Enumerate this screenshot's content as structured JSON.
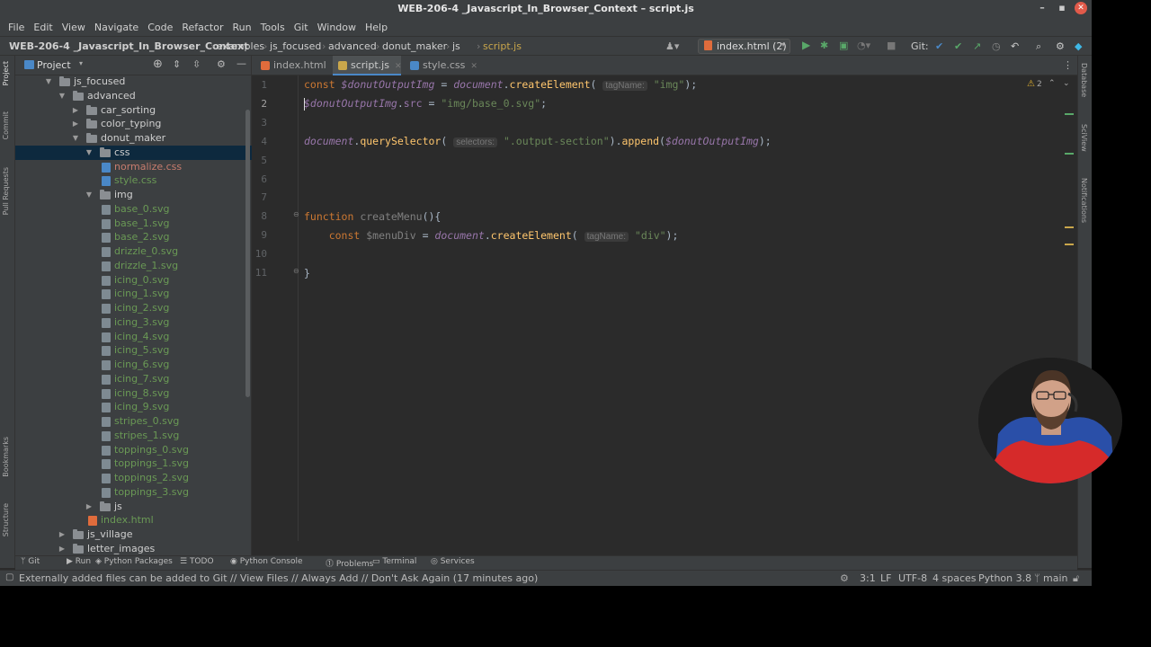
{
  "window": {
    "title": "WEB-206-4 _Javascript_In_Browser_Context – script.js"
  },
  "menu": [
    "File",
    "Edit",
    "View",
    "Navigate",
    "Code",
    "Refactor",
    "Run",
    "Tools",
    "Git",
    "Window",
    "Help"
  ],
  "breadcrumbs": [
    "WEB-206-4 _Javascript_In_Browser_Context",
    "examples",
    "js_focused",
    "advanced",
    "donut_maker",
    "js",
    "script.js"
  ],
  "run_config": "index.html (2)",
  "git_label": "Git:",
  "side_tabs": {
    "project": "Project",
    "commit": "Commit",
    "pull_requests": "Pull Requests",
    "bookmarks": "Bookmarks",
    "structure": "Structure",
    "database": "Database",
    "sciview": "SciView",
    "notifications": "Notifications"
  },
  "project": {
    "title": "Project",
    "tree": [
      {
        "label": "js_focused",
        "type": "folder",
        "depth": 2,
        "open": true
      },
      {
        "label": "advanced",
        "type": "folder",
        "depth": 3,
        "open": true
      },
      {
        "label": "car_sorting",
        "type": "folder",
        "depth": 4,
        "open": false
      },
      {
        "label": "color_typing",
        "type": "folder",
        "depth": 4,
        "open": false
      },
      {
        "label": "donut_maker",
        "type": "folder",
        "depth": 4,
        "open": true
      },
      {
        "label": "css",
        "type": "folder",
        "depth": 5,
        "open": true,
        "selected": true
      },
      {
        "label": "normalize.css",
        "type": "file",
        "depth": 6,
        "color": "#c77c6e"
      },
      {
        "label": "style.css",
        "type": "file",
        "depth": 6,
        "color": "#6a9955"
      },
      {
        "label": "img",
        "type": "folder",
        "depth": 5,
        "open": true
      },
      {
        "label": "base_0.svg",
        "type": "file",
        "depth": 6,
        "color": "#6a9955"
      },
      {
        "label": "base_1.svg",
        "type": "file",
        "depth": 6,
        "color": "#6a9955"
      },
      {
        "label": "base_2.svg",
        "type": "file",
        "depth": 6,
        "color": "#6a9955"
      },
      {
        "label": "drizzle_0.svg",
        "type": "file",
        "depth": 6,
        "color": "#6a9955"
      },
      {
        "label": "drizzle_1.svg",
        "type": "file",
        "depth": 6,
        "color": "#6a9955"
      },
      {
        "label": "icing_0.svg",
        "type": "file",
        "depth": 6,
        "color": "#6a9955"
      },
      {
        "label": "icing_1.svg",
        "type": "file",
        "depth": 6,
        "color": "#6a9955"
      },
      {
        "label": "icing_2.svg",
        "type": "file",
        "depth": 6,
        "color": "#6a9955"
      },
      {
        "label": "icing_3.svg",
        "type": "file",
        "depth": 6,
        "color": "#6a9955"
      },
      {
        "label": "icing_4.svg",
        "type": "file",
        "depth": 6,
        "color": "#6a9955"
      },
      {
        "label": "icing_5.svg",
        "type": "file",
        "depth": 6,
        "color": "#6a9955"
      },
      {
        "label": "icing_6.svg",
        "type": "file",
        "depth": 6,
        "color": "#6a9955"
      },
      {
        "label": "icing_7.svg",
        "type": "file",
        "depth": 6,
        "color": "#6a9955"
      },
      {
        "label": "icing_8.svg",
        "type": "file",
        "depth": 6,
        "color": "#6a9955"
      },
      {
        "label": "icing_9.svg",
        "type": "file",
        "depth": 6,
        "color": "#6a9955"
      },
      {
        "label": "stripes_0.svg",
        "type": "file",
        "depth": 6,
        "color": "#6a9955"
      },
      {
        "label": "stripes_1.svg",
        "type": "file",
        "depth": 6,
        "color": "#6a9955"
      },
      {
        "label": "toppings_0.svg",
        "type": "file",
        "depth": 6,
        "color": "#6a9955"
      },
      {
        "label": "toppings_1.svg",
        "type": "file",
        "depth": 6,
        "color": "#6a9955"
      },
      {
        "label": "toppings_2.svg",
        "type": "file",
        "depth": 6,
        "color": "#6a9955"
      },
      {
        "label": "toppings_3.svg",
        "type": "file",
        "depth": 6,
        "color": "#6a9955"
      },
      {
        "label": "js",
        "type": "folder",
        "depth": 5,
        "open": false
      },
      {
        "label": "index.html",
        "type": "file",
        "depth": 5,
        "color": "#6a9955"
      },
      {
        "label": "js_village",
        "type": "folder",
        "depth": 3,
        "open": false
      },
      {
        "label": "letter_images",
        "type": "folder",
        "depth": 3,
        "open": false
      }
    ]
  },
  "tabs": [
    {
      "label": "index.html",
      "icon": "html-file-icon",
      "active": false
    },
    {
      "label": "script.js",
      "icon": "js-file-icon",
      "active": true
    },
    {
      "label": "style.css",
      "icon": "css-file-icon",
      "active": false
    }
  ],
  "editor": {
    "inspection_count": "2",
    "current_line": 2,
    "lines": [
      "const $donutOutputImg = document.createElement( tagName: \"img\");",
      "$donutOutputImg.src = \"img/base_0.svg\";",
      "",
      "document.querySelector( selectors: \".output-section\").append($donutOutputImg);",
      "",
      "",
      "",
      "function createMenu(){",
      "    const $menuDiv = document.createElement( tagName: \"div\");",
      "",
      "}"
    ]
  },
  "bottom_tabs": [
    "Git",
    "Run",
    "Python Packages",
    "TODO",
    "Python Console",
    "Problems",
    "Terminal",
    "Services"
  ],
  "status": {
    "message": "Externally added files can be added to Git // View Files // Always Add // Don't Ask Again (17 minutes ago)",
    "position": "3:1",
    "line_sep": "LF",
    "encoding": "UTF-8",
    "indent": "4 spaces",
    "interpreter": "Python 3.8",
    "branch": "main"
  },
  "colors": {
    "accent": "#4a88c7",
    "editor_bg": "#2b2b2b",
    "panel_bg": "#3c3f41",
    "selection": "#0d293e",
    "keyword": "#cc7832",
    "string": "#6a8759",
    "function": "#ffc66d",
    "variable": "#9876aa"
  }
}
